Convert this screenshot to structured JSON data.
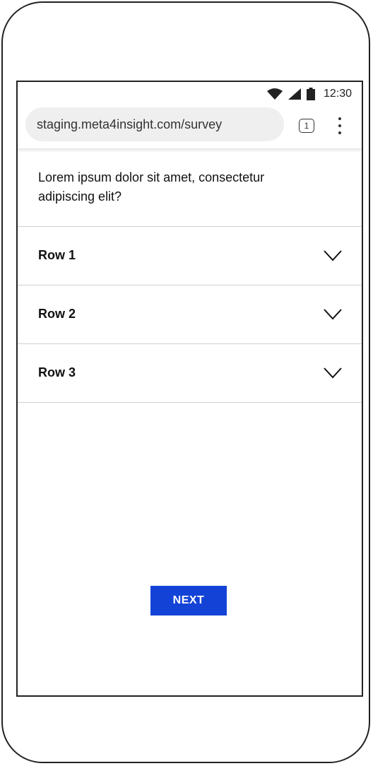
{
  "status_bar": {
    "time": "12:30",
    "icons": [
      "wifi-icon",
      "signal-icon",
      "battery-icon"
    ]
  },
  "browser": {
    "url": "staging.meta4insight.com/survey",
    "tab_count": "1",
    "menu_icon": "more-vert-icon"
  },
  "survey": {
    "question": "Lorem ipsum dolor sit amet, consectetur adipiscing elit?",
    "rows": [
      {
        "label": "Row 1",
        "icon": "chevron-down-icon"
      },
      {
        "label": "Row 2",
        "icon": "chevron-down-icon"
      },
      {
        "label": "Row 3",
        "icon": "chevron-down-icon"
      }
    ],
    "next_label": "NEXT"
  },
  "colors": {
    "primary_button": "#1343d6",
    "url_bar_bg": "#efeff0",
    "divider": "#cfcfcf"
  }
}
